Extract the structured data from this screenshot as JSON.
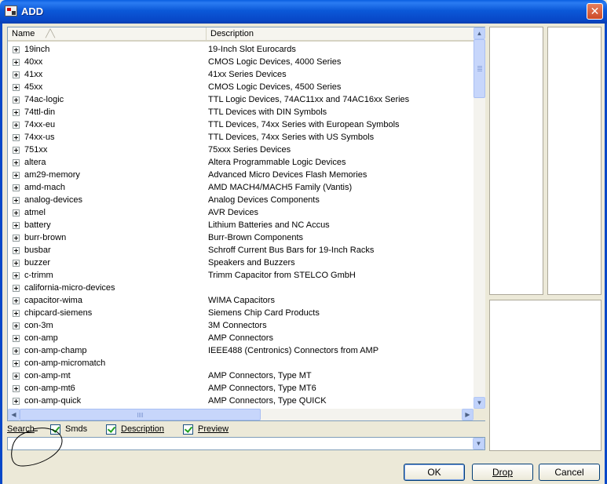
{
  "window": {
    "title": "ADD",
    "close_label": "✕"
  },
  "list": {
    "columns": {
      "name": "Name",
      "description": "Description",
      "sort_indicator": "╱╲"
    },
    "rows": [
      {
        "name": "19inch",
        "description": "19-Inch Slot Eurocards"
      },
      {
        "name": "40xx",
        "description": "CMOS Logic Devices, 4000 Series"
      },
      {
        "name": "41xx",
        "description": "41xx Series Devices"
      },
      {
        "name": "45xx",
        "description": "CMOS Logic Devices, 4500 Series"
      },
      {
        "name": "74ac-logic",
        "description": "TTL Logic Devices, 74AC11xx and 74AC16xx Series"
      },
      {
        "name": "74ttl-din",
        "description": "TTL Devices with DIN Symbols"
      },
      {
        "name": "74xx-eu",
        "description": "TTL Devices, 74xx Series with European Symbols"
      },
      {
        "name": "74xx-us",
        "description": "TTL Devices, 74xx Series with US Symbols"
      },
      {
        "name": "751xx",
        "description": "75xxx Series Devices"
      },
      {
        "name": "altera",
        "description": "Altera Programmable Logic Devices"
      },
      {
        "name": "am29-memory",
        "description": "Advanced Micro Devices Flash Memories"
      },
      {
        "name": "amd-mach",
        "description": "AMD MACH4/MACH5 Family (Vantis)"
      },
      {
        "name": "analog-devices",
        "description": "Analog Devices Components"
      },
      {
        "name": "atmel",
        "description": "AVR Devices"
      },
      {
        "name": "battery",
        "description": "Lithium Batteries and NC Accus"
      },
      {
        "name": "burr-brown",
        "description": "Burr-Brown Components"
      },
      {
        "name": "busbar",
        "description": "Schroff Current Bus Bars for 19-Inch Racks"
      },
      {
        "name": "buzzer",
        "description": "Speakers and Buzzers"
      },
      {
        "name": "c-trimm",
        "description": "Trimm Capacitor from STELCO GmbH"
      },
      {
        "name": "california-micro-devices",
        "description": ""
      },
      {
        "name": "capacitor-wima",
        "description": "WIMA Capacitors"
      },
      {
        "name": "chipcard-siemens",
        "description": "Siemens Chip Card Products"
      },
      {
        "name": "con-3m",
        "description": "3M Connectors"
      },
      {
        "name": "con-amp",
        "description": "AMP Connectors"
      },
      {
        "name": "con-amp-champ",
        "description": "IEEE488 (Centronics) Connectors from AMP"
      },
      {
        "name": "con-amp-micromatch",
        "description": ""
      },
      {
        "name": "con-amp-mt",
        "description": "AMP Connectors, Type MT"
      },
      {
        "name": "con-amp-mt6",
        "description": "AMP Connectors, Type MT6"
      },
      {
        "name": "con-amp-quick",
        "description": "AMP Connectors, Type QUICK"
      }
    ]
  },
  "search": {
    "label": "Search",
    "value": "",
    "options": [
      {
        "label": "Smds",
        "checked": true
      },
      {
        "label": "Description",
        "checked": true
      },
      {
        "label": "Preview",
        "checked": true
      }
    ]
  },
  "buttons": {
    "ok": "OK",
    "drop": "Drop",
    "cancel": "Cancel"
  },
  "icons": {
    "expand": "plus-box-icon",
    "scroll_up": "▲",
    "scroll_down": "▼",
    "scroll_left": "◀",
    "scroll_right": "▶",
    "combo_arrow": "▼"
  }
}
